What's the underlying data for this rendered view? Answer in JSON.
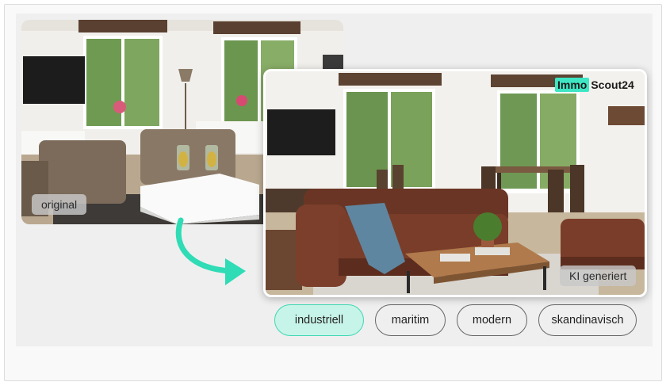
{
  "labels": {
    "original": "original",
    "ai_generated": "KI generiert"
  },
  "logo": {
    "part1": "Immo",
    "part2": "Scout24",
    "accent_color": "#3ee6c4"
  },
  "styles": {
    "selected": "industriell",
    "options": [
      {
        "label": "industriell",
        "active": true
      },
      {
        "label": "maritim",
        "active": false
      },
      {
        "label": "modern",
        "active": false
      },
      {
        "label": "skandinavisch",
        "active": false
      }
    ]
  },
  "colors": {
    "accent": "#3ed7b3",
    "active_chip_bg": "#c7f4e8",
    "arrow": "#2fdcb5"
  },
  "icons": {
    "transform_arrow": "curved-arrow-icon"
  }
}
